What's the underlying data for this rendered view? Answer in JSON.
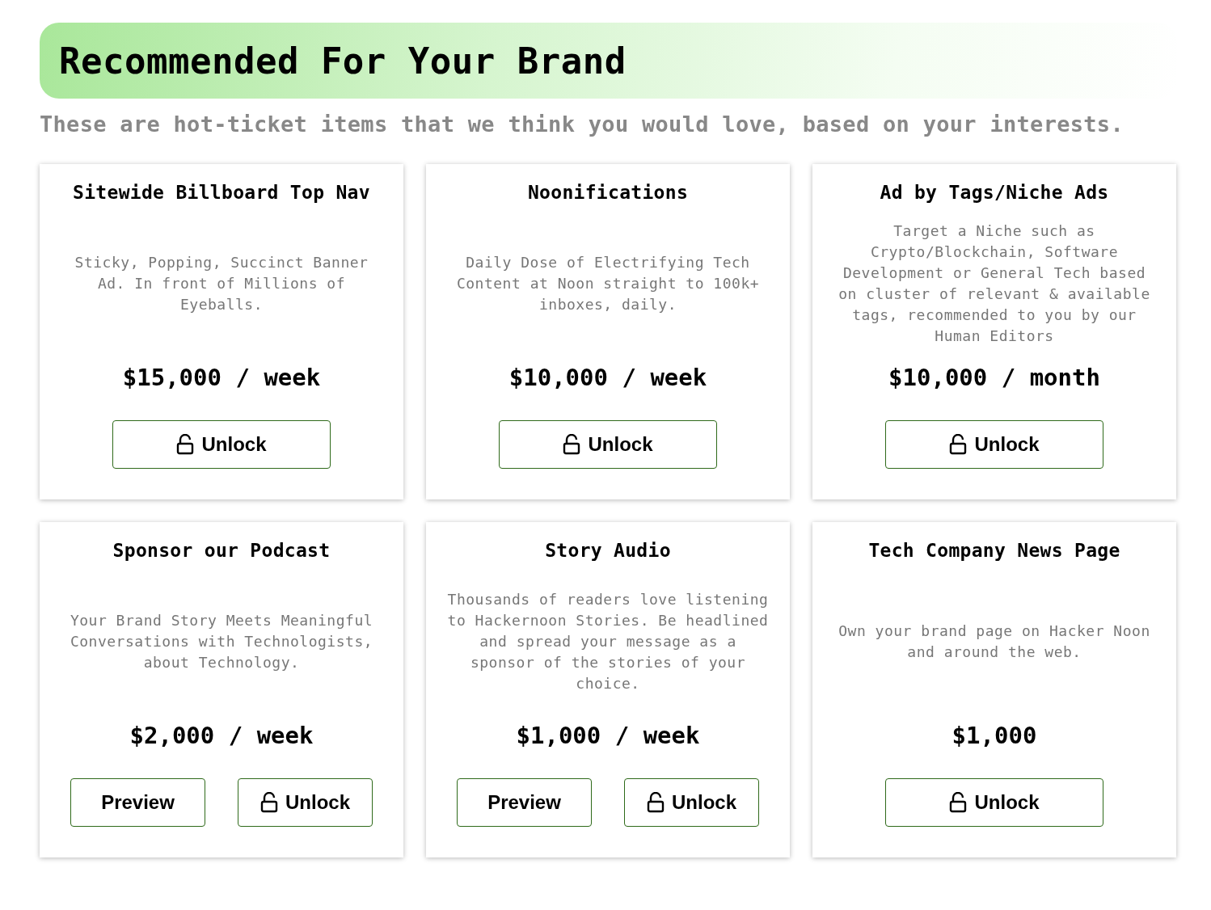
{
  "header": {
    "title": "Recommended For Your Brand",
    "subtitle": "These are hot-ticket items that we think you would love, based on your interests."
  },
  "cards": [
    {
      "title": "Sitewide Billboard Top Nav",
      "description": "Sticky, Popping, Succinct Banner Ad. In front of Millions of Eyeballs.",
      "price": "$15,000 / week",
      "buttons": [
        {
          "kind": "unlock",
          "label": "Unlock"
        }
      ]
    },
    {
      "title": "Noonifications",
      "description": "Daily Dose of Electrifying Tech Content at Noon straight to 100k+ inboxes, daily.",
      "price": "$10,000 / week",
      "buttons": [
        {
          "kind": "unlock",
          "label": "Unlock"
        }
      ]
    },
    {
      "title": "Ad by Tags/Niche Ads",
      "description": "Target a Niche such as Crypto/Blockchain, Software Development or General Tech based on cluster of relevant & available tags, recommended to you by our Human Editors",
      "price": "$10,000 / month",
      "buttons": [
        {
          "kind": "unlock",
          "label": "Unlock"
        }
      ]
    },
    {
      "title": "Sponsor our Podcast",
      "description": "Your Brand Story Meets Meaningful Conversations with Technologists, about Technology.",
      "price": "$2,000 / week",
      "buttons": [
        {
          "kind": "preview",
          "label": "Preview"
        },
        {
          "kind": "unlock",
          "label": "Unlock"
        }
      ]
    },
    {
      "title": "Story Audio",
      "description": "Thousands of readers love listening to Hackernoon Stories. Be headlined and spread your message as a sponsor of the stories of your choice.",
      "price": "$1,000 / week",
      "buttons": [
        {
          "kind": "preview",
          "label": "Preview"
        },
        {
          "kind": "unlock",
          "label": "Unlock"
        }
      ]
    },
    {
      "title": "Tech Company News Page",
      "description": "Own your brand page on Hacker Noon and around the web.",
      "price": "$1,000",
      "buttons": [
        {
          "kind": "unlock",
          "label": "Unlock"
        }
      ]
    }
  ]
}
